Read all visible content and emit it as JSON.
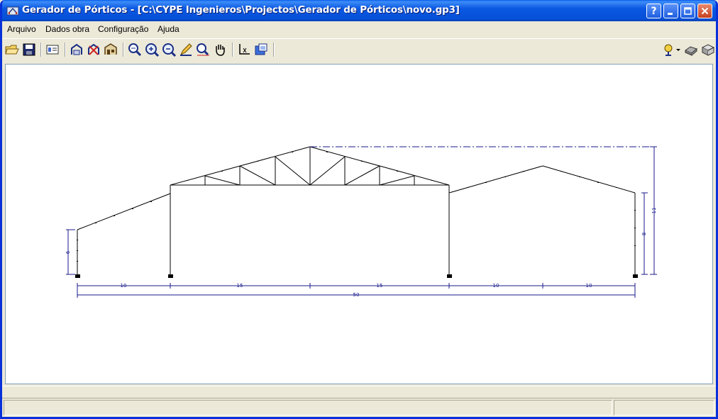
{
  "window": {
    "title": "Gerador de Pórticos - [C:\\CYPE Ingenieros\\Projectos\\Gerador de Pórticos\\novo.gp3]",
    "help_button": "?"
  },
  "menu": [
    {
      "label": "Arquivo"
    },
    {
      "label": "Dados obra"
    },
    {
      "label": "Configuração"
    },
    {
      "label": "Ajuda"
    }
  ],
  "toolbar_icons": [
    "open-folder-icon",
    "save-icon",
    "properties-icon",
    "frame-icon",
    "delete-frame-icon",
    "build-icon",
    "zoom-window-icon",
    "zoom-all-icon",
    "zoom-previous-icon",
    "pencil-icon",
    "measure-icon",
    "pan-hand-icon",
    "axes-icon",
    "view-3d-icon",
    "location-icon",
    "print-icon",
    "export-icon"
  ],
  "drawing": {
    "dimensions": {
      "bottom_spans": [
        "10",
        "15",
        "15",
        "10",
        "10"
      ],
      "overall": "50",
      "left_height": "6",
      "right_height": "8",
      "ridge_height": "11"
    },
    "line_color": "#000000",
    "dimension_color": "#1A1A8C"
  },
  "status": {
    "left": "",
    "right": ""
  }
}
